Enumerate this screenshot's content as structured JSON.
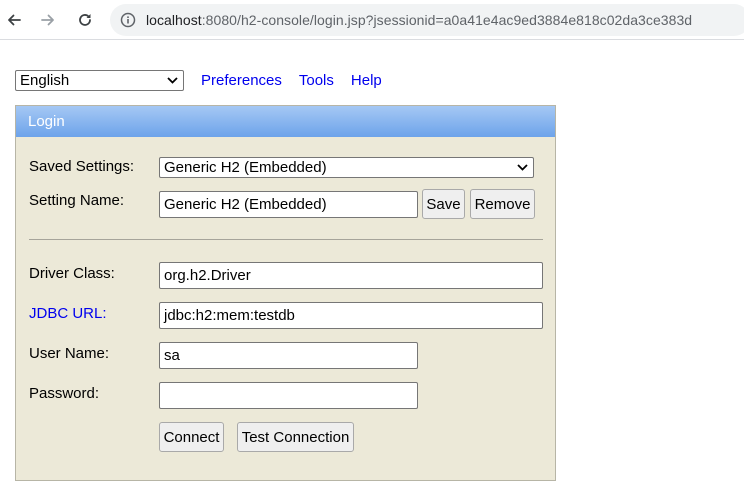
{
  "browser": {
    "url_host": "localhost",
    "url_rest": ":8080/h2-console/login.jsp?jsessionid=a0a41e4ac9ed3884e818c02da3ce383d",
    "back_icon": "arrow-left-icon",
    "forward_icon": "arrow-right-icon",
    "reload_icon": "reload-icon",
    "info_icon": "info-icon"
  },
  "top_menu": {
    "language": "English",
    "links": [
      "Preferences",
      "Tools",
      "Help"
    ]
  },
  "login": {
    "header": "Login",
    "saved_settings_label": "Saved Settings:",
    "saved_settings_value": "Generic H2 (Embedded)",
    "setting_name_label": "Setting Name:",
    "setting_name_value": "Generic H2 (Embedded)",
    "save_label": "Save",
    "remove_label": "Remove",
    "driver_class_label": "Driver Class:",
    "driver_class_value": "org.h2.Driver",
    "jdbc_url_label": "JDBC URL:",
    "jdbc_url_value": "jdbc:h2:mem:testdb",
    "user_name_label": "User Name:",
    "user_name_value": "sa",
    "password_label": "Password:",
    "password_value": "",
    "connect_label": "Connect",
    "test_connection_label": "Test Connection"
  },
  "colors": {
    "panel_bg": "#ece9d8",
    "header_gradient_top": "#a5c8f4",
    "header_gradient_bottom": "#6da3ea",
    "link": "#0000ee"
  }
}
